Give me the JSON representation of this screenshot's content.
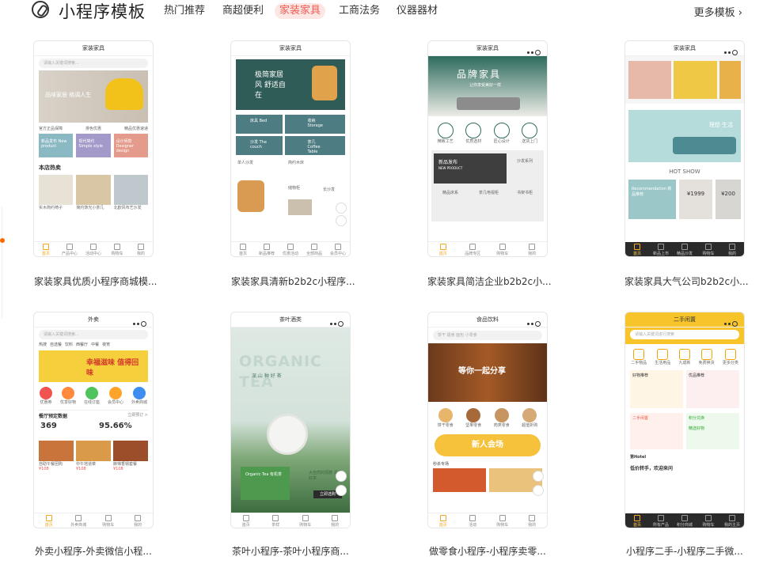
{
  "header": {
    "brand": "小程序模板",
    "tabs": [
      "热门推荐",
      "商超便利",
      "家装家具",
      "工商法务",
      "仪器器材"
    ],
    "active_tab": "家装家具",
    "more": "更多模板 ›"
  },
  "cards": [
    {
      "caption": "家装家具优质小程序商城模...",
      "title": "家装家具",
      "search": "请输入关键词搜索...",
      "banner": "品味家居 格调人生",
      "badges": [
        "官方正品保障",
        "排色优惠",
        "精品优惠速递"
      ],
      "tiles": [
        "新品发布 New product",
        "现代简约 Simple style",
        "设计师款 Designer design"
      ],
      "section": "本店热卖",
      "products": [
        "实木简约椅子",
        "简约饰光小茶几",
        "北欧风布艺沙发"
      ],
      "tabs": [
        "首页",
        "产品中心",
        "活动中心",
        "购物车",
        "我的"
      ]
    },
    {
      "caption": "家装家具清新b2b2c小程序...",
      "title": "家装家具",
      "banner": "极简家居风 舒适自在",
      "grid": [
        "床具 Bed",
        "收纳 Storage",
        "沙发 The couch",
        "茶几 Coffee Table"
      ],
      "items": [
        "单人沙发",
        "简约木床",
        "储物柜",
        "长沙发"
      ],
      "tabs": [
        "首页",
        "新品推荐",
        "优惠活动",
        "全部商品",
        "会员中心"
      ]
    },
    {
      "caption": "家装家具简洁企业b2b2c小...",
      "title": "家装家具",
      "banner": "品牌家具",
      "banner_sub": "让你享受美好一样",
      "icons": [
        "精致工艺",
        "优质选材",
        "匠心设计",
        "送货上门"
      ],
      "new": "新品发布",
      "new_sub": "NEW PRODUCT",
      "items": [
        "沙发系列",
        "精品床系",
        "茶几电视柜",
        "书架书柜"
      ],
      "tabs": [
        "首页",
        "品牌专区",
        "购物车",
        "我的"
      ]
    },
    {
      "caption": "家装家具大气公司b2b2c小...",
      "title": "家装家具",
      "banner": "理想·生活",
      "hot": "HOT SHOW",
      "tag": "Recommendation 新品推荐",
      "prices": [
        "¥1999",
        "¥200"
      ],
      "tabs": [
        "首页",
        "新品上市",
        "精品沙发",
        "购物车",
        "我的"
      ]
    },
    {
      "caption": "外卖小程序-外卖微信小程...",
      "title": "外卖",
      "search": "请输入关键词搜索...",
      "hot_tags": [
        "热搜",
        "自选餐",
        "饮料",
        "西餐厅",
        "中餐",
        "夜宵"
      ],
      "banner": "幸福滋味 值得回味",
      "icons": [
        "优惠券",
        "优享好物",
        "在线订座",
        "会员中心",
        "外卖商城"
      ],
      "stats_title": "餐厅预定数据",
      "stats_link": "立即预订 >",
      "stat1": "369",
      "stat2": "95.66%",
      "foods": [
        "自助午餐团购",
        "中午地道菜",
        "麻辣香锅套餐"
      ],
      "price": "¥108",
      "tabs": [
        "首页",
        "外卖商城",
        "购物车",
        "我的"
      ]
    },
    {
      "caption": "茶叶小程序-茶叶小程序商...",
      "title": "茶叶酒类",
      "banner_big": "ORGANIC TEA",
      "banner_cn": "深 山 种 好 茶",
      "promo": "Organic Tea 有机茶",
      "promo2": "大自然的馈赠 清香好茶",
      "button": "立即选购",
      "tabs": [
        "首页",
        "茶样",
        "购物车",
        "我的"
      ]
    },
    {
      "caption": "做零食小程序-小程序卖零...",
      "title": "食品饮料",
      "search": "饼干 甜食 面包 小零食",
      "banner": "等你一起分享",
      "icons": [
        "饼干零食",
        "坚果零食",
        "肉类零食",
        "超值折购"
      ],
      "promo": "新人会场",
      "flash": "秒杀专场",
      "tabs": [
        "首页",
        "活动",
        "购物车",
        "我的"
      ]
    },
    {
      "caption": "小程序二手-小程序二手微...",
      "title": "二手闲置",
      "search": "请输入关键词进行搜索",
      "icons": [
        "二手物品",
        "生活用品",
        "九成新",
        "免费换货",
        "更多分类"
      ],
      "cats": [
        "好物推荐",
        "优品推荐"
      ],
      "sub": [
        "二手闲置",
        "积分兑换",
        "精选好物"
      ],
      "user": "第Hotel",
      "desc": "低价转手，欢迎来问",
      "tabs": [
        "首页",
        "所有产品",
        "积分商城",
        "购物车",
        "我的主页"
      ]
    }
  ]
}
